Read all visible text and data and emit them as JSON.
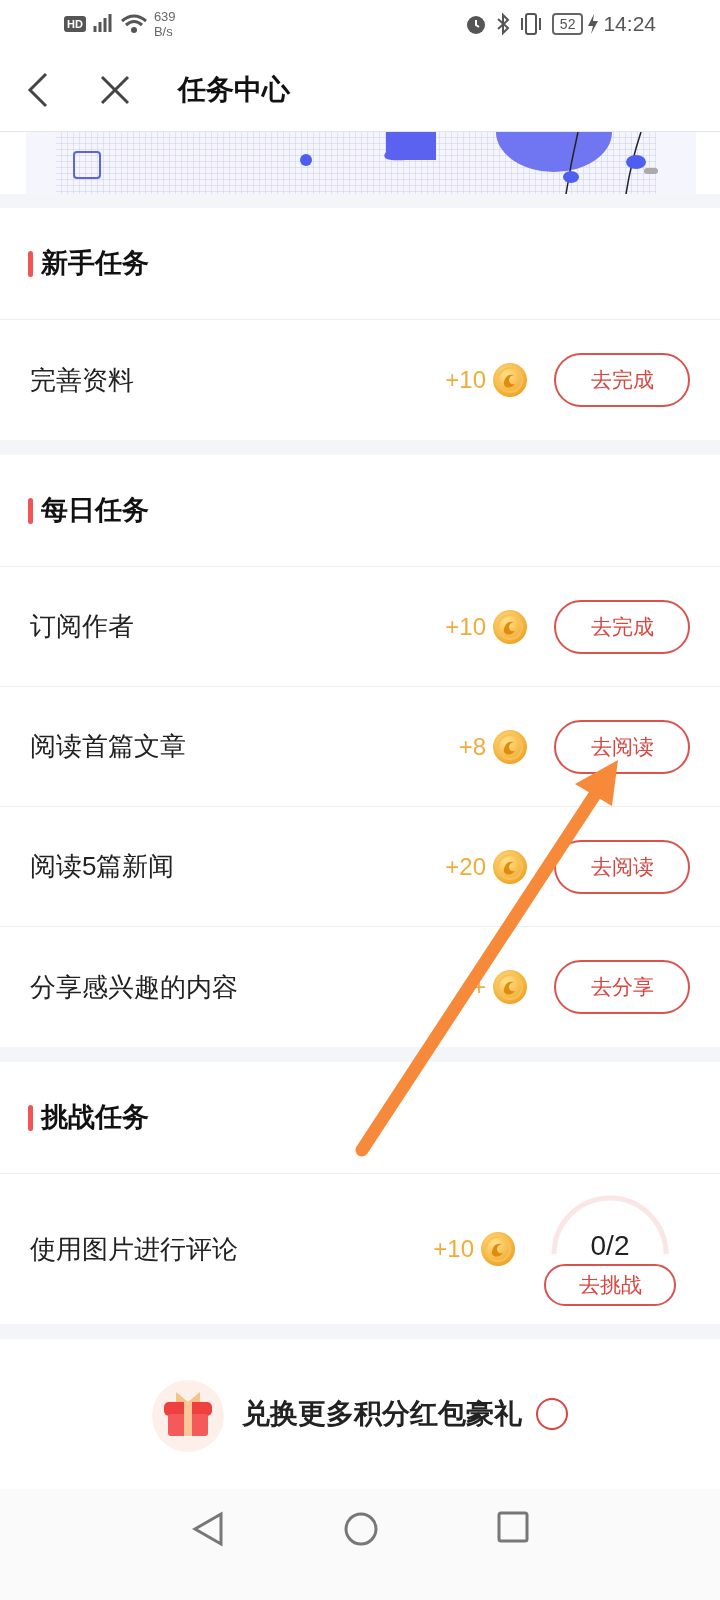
{
  "status_bar": {
    "badge": "HD",
    "speed_value": "639",
    "speed_unit": "B/s",
    "battery": "52",
    "time": "14:24"
  },
  "header": {
    "title": "任务中心"
  },
  "sections": [
    {
      "title": "新手任务",
      "tasks": [
        {
          "kind": "button",
          "name": "完善资料",
          "points": "+10",
          "button": "去完成"
        }
      ]
    },
    {
      "title": "每日任务",
      "tasks": [
        {
          "kind": "button",
          "name": "订阅作者",
          "points": "+10",
          "button": "去完成"
        },
        {
          "kind": "button",
          "name": "阅读首篇文章",
          "points": "+8",
          "button": "去阅读"
        },
        {
          "kind": "button",
          "name": "阅读5篇新闻",
          "points": "+20",
          "button": "去阅读"
        },
        {
          "kind": "button",
          "name": "分享感兴趣的内容",
          "points": "+",
          "button": "去分享"
        }
      ]
    },
    {
      "title": "挑战任务",
      "tasks": [
        {
          "kind": "progress",
          "name": "使用图片进行评论",
          "points": "+10",
          "progress": "0/2",
          "button": "去挑战"
        }
      ]
    }
  ],
  "promo": {
    "text": "兑换更多积分红包豪礼"
  }
}
